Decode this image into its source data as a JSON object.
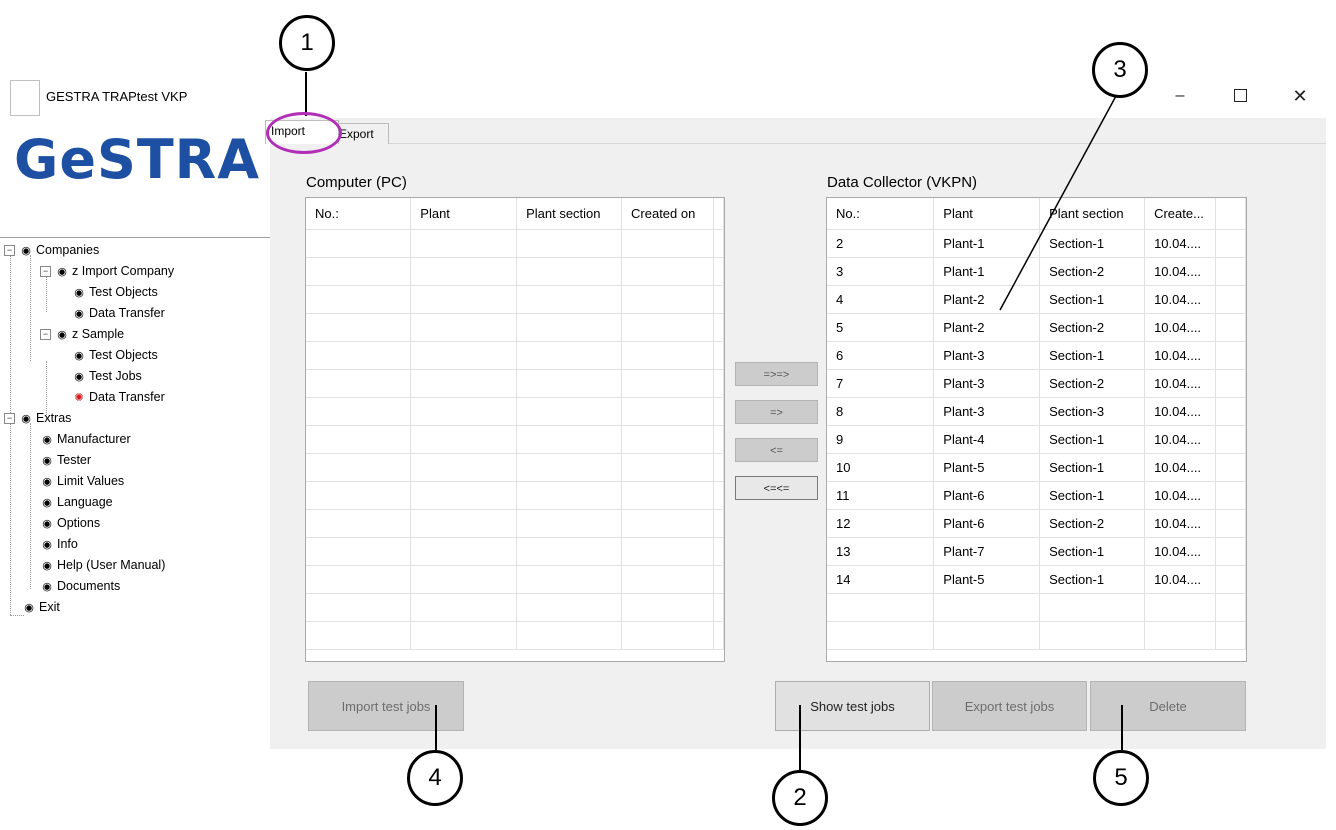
{
  "window": {
    "title": "GESTRA TRAPtest VKP",
    "minimize_glyph": "–",
    "close_glyph": "✕"
  },
  "logo": {
    "text": "GeSTRA"
  },
  "tree": {
    "items": [
      {
        "label": "Companies",
        "icon": "radio-bullet-icon"
      },
      {
        "label": "z Import Company",
        "icon": "radio-bullet-icon"
      },
      {
        "label": "Test Objects",
        "icon": "radio-bullet-icon"
      },
      {
        "label": "Data Transfer",
        "icon": "radio-bullet-icon"
      },
      {
        "label": "z Sample",
        "icon": "radio-bullet-icon"
      },
      {
        "label": "Test Objects",
        "icon": "radio-bullet-icon"
      },
      {
        "label": "Test Jobs",
        "icon": "radio-bullet-icon"
      },
      {
        "label": "Data Transfer",
        "icon": "active-red-bullet-icon"
      },
      {
        "label": "Extras",
        "icon": "radio-bullet-icon"
      },
      {
        "label": "Manufacturer",
        "icon": "radio-bullet-icon"
      },
      {
        "label": "Tester",
        "icon": "radio-bullet-icon"
      },
      {
        "label": "Limit Values",
        "icon": "radio-bullet-icon"
      },
      {
        "label": "Language",
        "icon": "radio-bullet-icon"
      },
      {
        "label": "Options",
        "icon": "radio-bullet-icon"
      },
      {
        "label": "Info",
        "icon": "radio-bullet-icon"
      },
      {
        "label": "Help (User Manual)",
        "icon": "radio-bullet-icon"
      },
      {
        "label": "Documents",
        "icon": "radio-bullet-icon"
      },
      {
        "label": "Exit",
        "icon": "radio-bullet-icon"
      }
    ]
  },
  "tabs": [
    {
      "label": "Import"
    },
    {
      "label": "Export"
    }
  ],
  "pc": {
    "label": "Computer (PC)",
    "columns": [
      "No.:",
      "Plant",
      "Plant section",
      "Created on"
    ]
  },
  "vkpn": {
    "label": "Data Collector (VKPN)",
    "columns": [
      "No.:",
      "Plant",
      "Plant section",
      "Create..."
    ],
    "rows": [
      [
        "2",
        "Plant-1",
        "Section-1",
        "10.04...."
      ],
      [
        "3",
        "Plant-1",
        "Section-2",
        "10.04...."
      ],
      [
        "4",
        "Plant-2",
        "Section-1",
        "10.04...."
      ],
      [
        "5",
        "Plant-2",
        "Section-2",
        "10.04...."
      ],
      [
        "6",
        "Plant-3",
        "Section-1",
        "10.04...."
      ],
      [
        "7",
        "Plant-3",
        "Section-2",
        "10.04...."
      ],
      [
        "8",
        "Plant-3",
        "Section-3",
        "10.04...."
      ],
      [
        "9",
        "Plant-4",
        "Section-1",
        "10.04...."
      ],
      [
        "10",
        "Plant-5",
        "Section-1",
        "10.04...."
      ],
      [
        "11",
        "Plant-6",
        "Section-1",
        "10.04...."
      ],
      [
        "12",
        "Plant-6",
        "Section-2",
        "10.04...."
      ],
      [
        "13",
        "Plant-7",
        "Section-1",
        "10.04...."
      ],
      [
        "14",
        "Plant-5",
        "Section-1",
        "10.04...."
      ]
    ]
  },
  "transfer_buttons": {
    "all_right": "=>=>",
    "right": "=>",
    "left": "<=",
    "all_left": "<=<="
  },
  "actions": {
    "import": "Import test jobs",
    "show": "Show test jobs",
    "export": "Export test jobs",
    "delete": "Delete"
  },
  "callouts": [
    "1",
    "2",
    "3",
    "4",
    "5"
  ],
  "colors": {
    "logo": "#1d4fa3",
    "highlight_ring": "#b12fb6",
    "active_node": "#d21a1a",
    "panel_bg": "#f0f0f0"
  }
}
